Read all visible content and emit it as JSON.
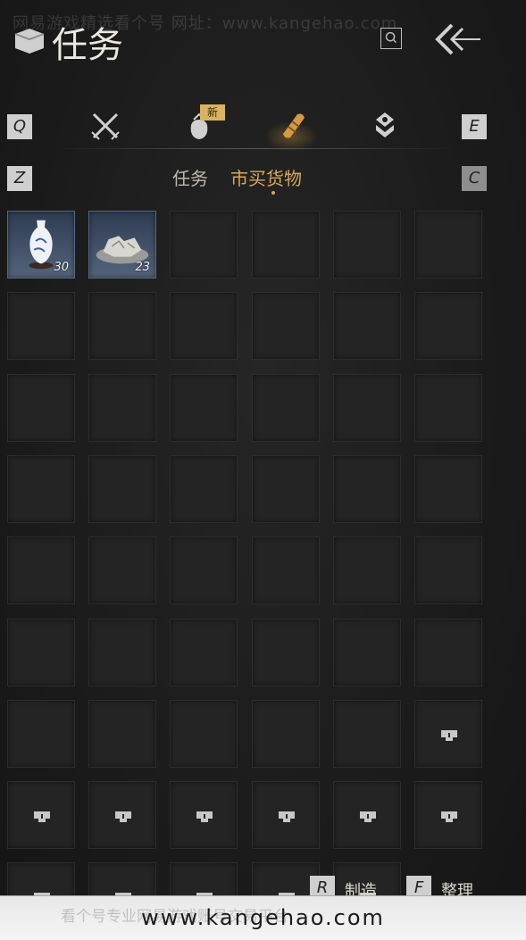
{
  "watermark": {
    "top": "网易游戏精选看个号  网址：www.kangehao.com",
    "bottom_url": "www.kangehao.com",
    "bottom_faint": "看个号专业网易游戏账号交易平台"
  },
  "header": {
    "title": "任务",
    "search_icon": "search-icon",
    "back_icon": "back-arrow-icon"
  },
  "keys": {
    "q": "Q",
    "e": "E",
    "z": "Z",
    "c": "C",
    "r": "R",
    "f": "F"
  },
  "tabs": [
    {
      "icon": "crossed-swords-icon",
      "active": false
    },
    {
      "icon": "bag-icon",
      "active": false,
      "badge": "新"
    },
    {
      "icon": "scroll-icon",
      "active": true
    },
    {
      "icon": "gem-icon",
      "active": false
    }
  ],
  "subtabs": {
    "inactive": "任务",
    "active": "市买货物"
  },
  "inventory": {
    "items": [
      {
        "name": "porcelain-vase",
        "count": "30"
      },
      {
        "name": "stone-ore",
        "count": "23"
      }
    ],
    "empty_slots": 39,
    "locked_slots": 12
  },
  "footer": {
    "craft_label": "制造",
    "sort_label": "整理"
  },
  "colors": {
    "accent": "#d7a85a",
    "slot_bg": "#242424",
    "item_bg": "#54647c"
  }
}
